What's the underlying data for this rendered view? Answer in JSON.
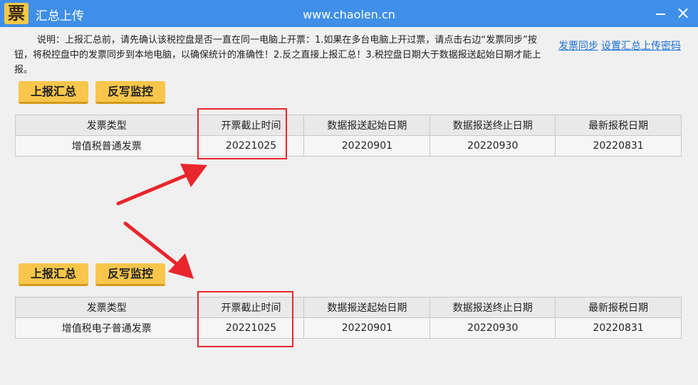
{
  "window": {
    "logo_char": "票",
    "title": "汇总上传",
    "site": "www.chaolen.cn",
    "minimize_label": "",
    "close_label": "×"
  },
  "notice": "说明：上报汇总前，请先确认该税控盘是否一直在同一电脑上开票：1.如果在多台电脑上开过票，请点击右边“发票同步”按钮，将税控盘中的发票同步到本地电脑，以确保统计的准确性！2.反之直接上报汇总！3.税控盘日期大于数据报送起始日期才能上报。",
  "links": {
    "sync": "发票同步",
    "set_password": "设置汇总上传密码"
  },
  "buttons": {
    "report_summary": "上报汇总",
    "writeback_monitor": "反写监控"
  },
  "columns": [
    "发票类型",
    "开票截止时间",
    "数据报送起始日期",
    "数据报送终止日期",
    "最新报税日期"
  ],
  "panels": [
    {
      "row": [
        "增值税普通发票",
        "20221025",
        "20220901",
        "20220930",
        "20220831"
      ]
    },
    {
      "row": [
        "增值税电子普通发票",
        "20221025",
        "20220901",
        "20220930",
        "20220831"
      ]
    }
  ],
  "colors": {
    "titlebar": "#3f8fe8",
    "button": "#f7c64b",
    "link": "#1a6fd6",
    "highlight": "#e8262c"
  }
}
